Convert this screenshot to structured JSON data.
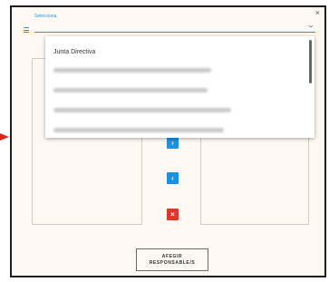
{
  "select": {
    "label": "Selecciona"
  },
  "dropdown": {
    "options": [
      "Junta Directiva"
    ],
    "blurred_option_count": 4
  },
  "modal": {
    "close_symbol": "×",
    "button_add_line1": "AFEGIR",
    "button_add_line2": "RESPONSABLE/S"
  },
  "transfer": {
    "right_symbol": "›",
    "left_symbol": "‹",
    "delete_symbol": "×"
  },
  "colors": {
    "accent": "#1e90e0",
    "danger": "#e0372d",
    "pointer": "#d9261c"
  }
}
